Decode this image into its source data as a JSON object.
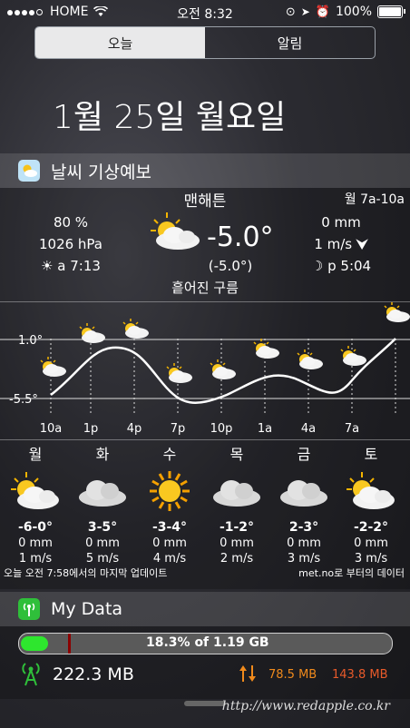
{
  "status": {
    "carrier": "HOME",
    "time": "오전 8:32",
    "battery": "100%"
  },
  "tabs": [
    {
      "label": "오늘"
    },
    {
      "label": "알림"
    }
  ],
  "date": "1월 25일 월요일",
  "weather": {
    "header": "날씨 기상예보",
    "city": "맨해튼",
    "period": "월 7a-10a",
    "humidity": "80 %",
    "pressure": "1026 hPa",
    "sunrise": "a 7:13",
    "temp": "-5.0°",
    "feels": "(-5.0°)",
    "condition": "흩어진 구름",
    "precip": "0 mm",
    "wind": "1 m/s",
    "sunset": "p 5:04",
    "chart": {
      "ymax_label": "1.0°",
      "ymin_label": "-5.5°",
      "hours": [
        "10a",
        "1p",
        "4p",
        "7p",
        "10p",
        "1a",
        "4a",
        "7a"
      ]
    },
    "days": [
      {
        "name": "월",
        "temp": "-6-0°",
        "precip": "0 mm",
        "wind": "1 m/s",
        "icon": "partly-cloudy-icon"
      },
      {
        "name": "화",
        "temp": "3-5°",
        "precip": "0 mm",
        "wind": "5 m/s",
        "icon": "cloud-icon"
      },
      {
        "name": "수",
        "temp": "-3-4°",
        "precip": "0 mm",
        "wind": "4 m/s",
        "icon": "sun-icon"
      },
      {
        "name": "목",
        "temp": "-1-2°",
        "precip": "0 mm",
        "wind": "2 m/s",
        "icon": "cloud-icon"
      },
      {
        "name": "금",
        "temp": "2-3°",
        "precip": "0 mm",
        "wind": "3 m/s",
        "icon": "cloud-icon"
      },
      {
        "name": "토",
        "temp": "-2-2°",
        "precip": "0 mm",
        "wind": "3 m/s",
        "icon": "partly-cloudy-icon"
      }
    ],
    "footer_left": "오늘 오전 7:58에서의 마지막 업데이트",
    "footer_right": "met.no로 부터의 데이터"
  },
  "mydata": {
    "header": "My Data",
    "usage_label": "18.3% of 1.19 GB",
    "usage_fraction": 0.183,
    "cellular": "222.3 MB",
    "upload": "78.5 MB",
    "download": "143.8 MB"
  },
  "watermark": "http://www.redapple.co.kr"
}
